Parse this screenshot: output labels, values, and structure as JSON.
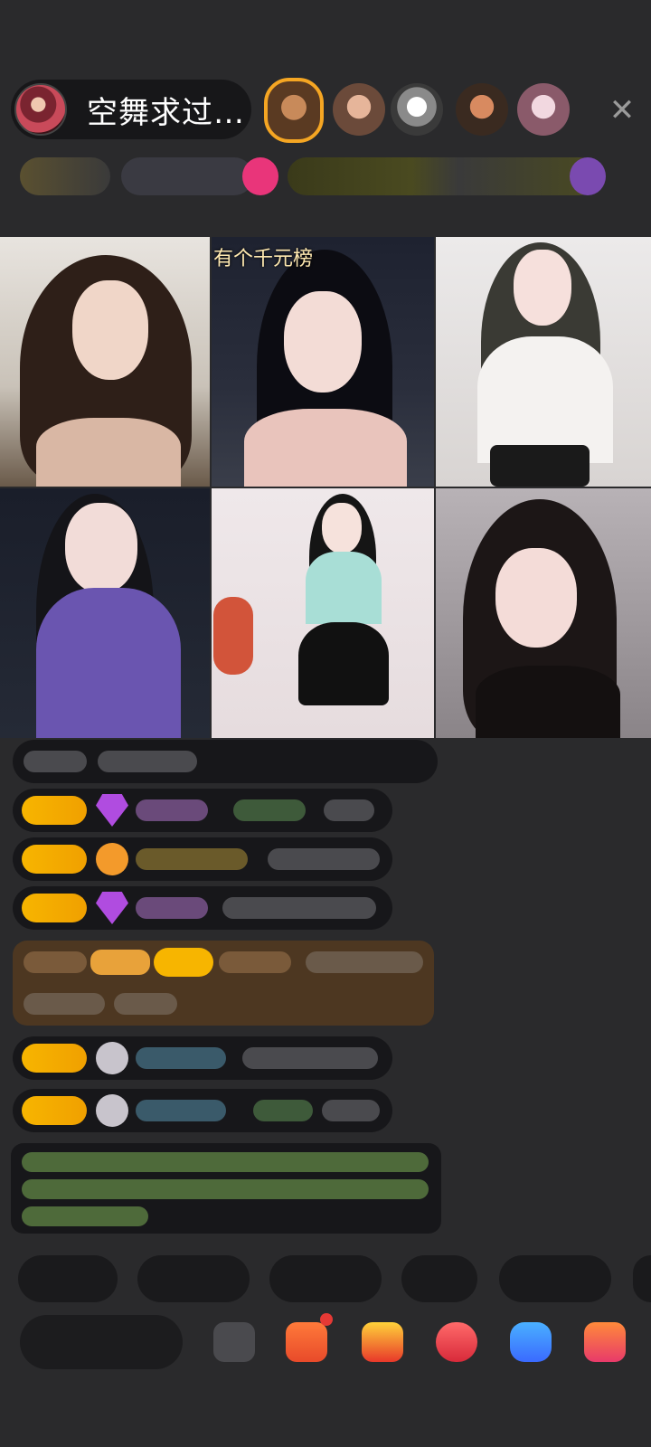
{
  "host": {
    "title": "空舞求过…",
    "avatar_icon": "host-avatar"
  },
  "close_icon": "✕",
  "grid_tiles": [
    {
      "caption": ""
    },
    {
      "caption": "有个千元榜"
    },
    {
      "caption": ""
    },
    {
      "caption": ""
    },
    {
      "caption": ""
    },
    {
      "caption": ""
    }
  ],
  "colors": {
    "background": "#2a2a2c",
    "level_badge": "#f7b500",
    "gem_purple": "#b04ce0",
    "gift_orange": "#f39a2b",
    "system_green": "#9bd06a",
    "notify_red": "#e53935"
  }
}
